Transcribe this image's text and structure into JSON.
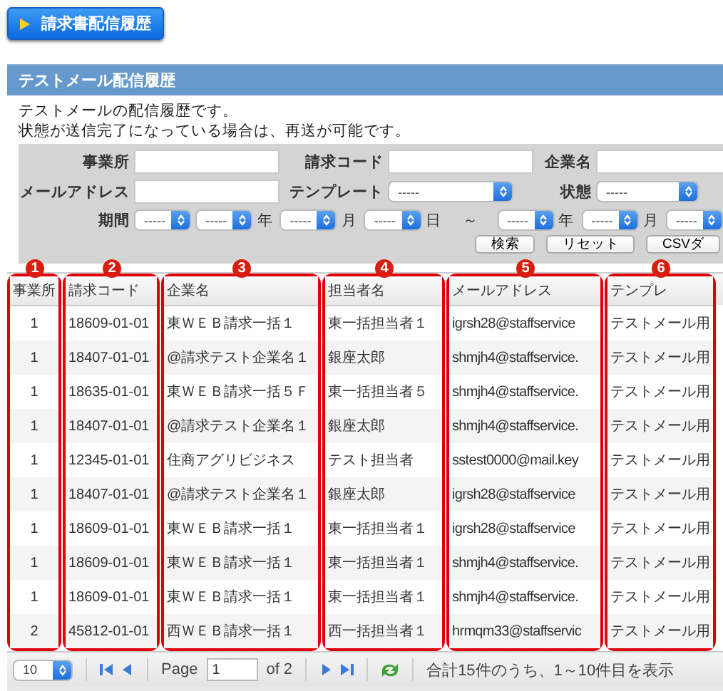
{
  "nav_button": {
    "label": "請求書配信履歴"
  },
  "panel": {
    "title": "テストメール配信履歴",
    "description": [
      "テストメールの配信履歴です。",
      "状態が送信完了になっている場合は、再送が可能です。"
    ]
  },
  "search_form": {
    "fields": [
      {
        "label": "事業所",
        "kind": "text"
      },
      {
        "label": "請求コード",
        "kind": "text"
      },
      {
        "label": "企業名",
        "kind": "text"
      },
      {
        "label": "メールアドレス",
        "kind": "text"
      },
      {
        "label": "テンプレート",
        "kind": "select",
        "value": "-----"
      },
      {
        "label": "状態",
        "kind": "select",
        "value": "-----"
      }
    ],
    "period": {
      "label": "期間",
      "parts": [
        {
          "kind": "select",
          "value": "-----"
        },
        {
          "kind": "select",
          "value": "-----",
          "suffix": "年"
        },
        {
          "kind": "select",
          "value": "-----",
          "suffix": "月"
        },
        {
          "kind": "select",
          "value": "-----",
          "suffix": "日"
        },
        {
          "kind": "text",
          "text": "～"
        },
        {
          "kind": "select",
          "value": "-----",
          "suffix": "年"
        },
        {
          "kind": "select",
          "value": "-----",
          "suffix": "月"
        },
        {
          "kind": "select",
          "value": "-----"
        }
      ]
    },
    "buttons": [
      "検索",
      "リセット",
      "CSVダ"
    ]
  },
  "table": {
    "columns": [
      {
        "title": "事業所",
        "marker": "1"
      },
      {
        "title": "請求コード",
        "marker": "2"
      },
      {
        "title": "企業名",
        "marker": "3"
      },
      {
        "title": "担当者名",
        "marker": "4"
      },
      {
        "title": "メールアドレス",
        "marker": "5"
      },
      {
        "title": "テンプレ",
        "marker": "6"
      }
    ],
    "rows": [
      [
        "1",
        "18609-01-01",
        "東ＷＥＢ請求一括１",
        "東一括担当者１",
        "igrsh28@staffservice",
        "テストメール用"
      ],
      [
        "1",
        "18407-01-01",
        "@請求テスト企業名１",
        "銀座太郎",
        "shmjh4@staffservice.",
        "テストメール用"
      ],
      [
        "1",
        "18635-01-01",
        "東ＷＥＢ請求一括５Ｆ",
        "東一括担当者５",
        "shmjh4@staffservice.",
        "テストメール用"
      ],
      [
        "1",
        "18407-01-01",
        "@請求テスト企業名１",
        "銀座太郎",
        "shmjh4@staffservice.",
        "テストメール用"
      ],
      [
        "1",
        "12345-01-01",
        "住商アグリビジネス",
        "テスト担当者",
        "sstest0000@mail.key",
        "テストメール用"
      ],
      [
        "1",
        "18407-01-01",
        "@請求テスト企業名１",
        "銀座太郎",
        "igrsh28@staffservice",
        "テストメール用"
      ],
      [
        "1",
        "18609-01-01",
        "東ＷＥＢ請求一括１",
        "東一括担当者１",
        "igrsh28@staffservice",
        "テストメール用"
      ],
      [
        "1",
        "18609-01-01",
        "東ＷＥＢ請求一括１",
        "東一括担当者１",
        "shmjh4@staffservice.",
        "テストメール用"
      ],
      [
        "1",
        "18609-01-01",
        "東ＷＥＢ請求一括１",
        "東一括担当者１",
        "shmjh4@staffservice.",
        "テストメール用"
      ],
      [
        "2",
        "45812-01-01",
        "西ＷＥＢ請求一括１",
        "西一括担当者１",
        "hrmqm33@staffservic",
        "テストメール用"
      ]
    ]
  },
  "pager": {
    "page_size": "10",
    "page_label": "Page",
    "page": "1",
    "of_label": "of 2",
    "summary": "合計15件のうち、1～10件目を表示"
  }
}
